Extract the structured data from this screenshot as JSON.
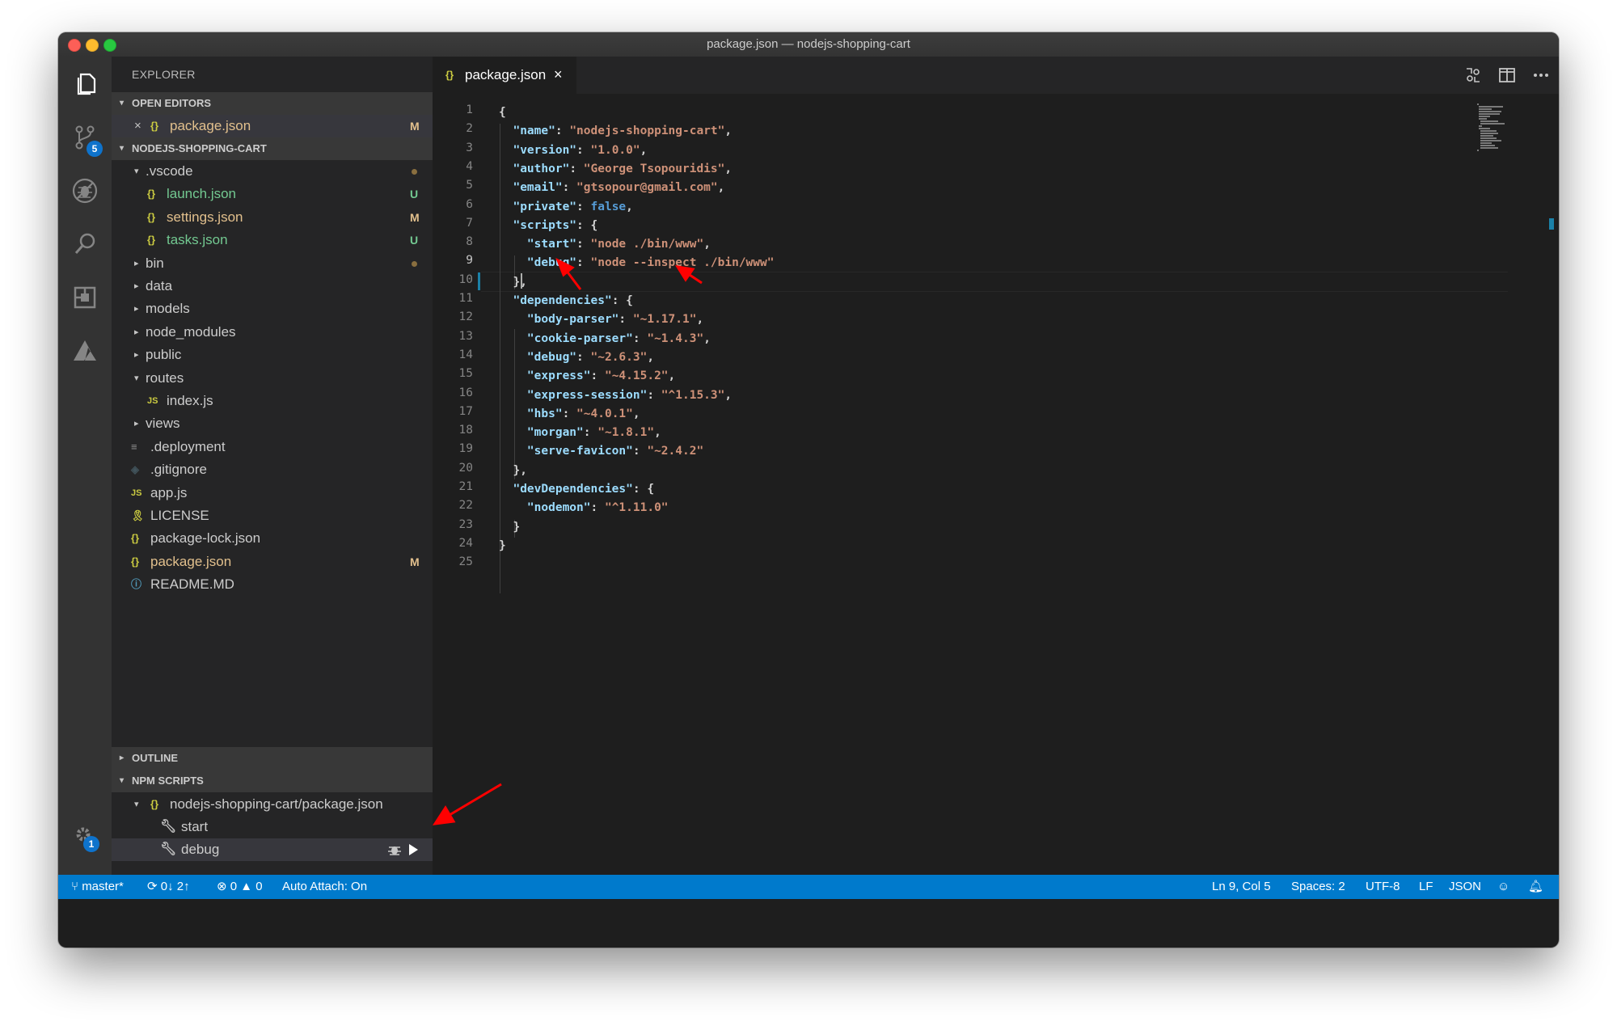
{
  "window": {
    "title": "package.json — nodejs-shopping-cart"
  },
  "activity_bar": {
    "scm_badge": "5",
    "settings_badge": "1"
  },
  "sidebar": {
    "title": "EXPLORER",
    "open_editors": {
      "label": "OPEN EDITORS",
      "items": [
        {
          "icon": "{}",
          "name": "package.json",
          "status": "M"
        }
      ]
    },
    "project": {
      "label": "NODEJS-SHOPPING-CART",
      "items": [
        {
          "name": ".vscode",
          "icon": "",
          "twisty": "▾",
          "status": "",
          "dot": true
        },
        {
          "name": "launch.json",
          "icon": "{}",
          "twisty": "",
          "status": "U"
        },
        {
          "name": "settings.json",
          "icon": "{}",
          "twisty": "",
          "status": "M"
        },
        {
          "name": "tasks.json",
          "icon": "{}",
          "twisty": "",
          "status": "U"
        },
        {
          "name": "bin",
          "icon": "",
          "twisty": "▸",
          "status": "",
          "dot": true
        },
        {
          "name": "data",
          "icon": "",
          "twisty": "▸",
          "status": ""
        },
        {
          "name": "models",
          "icon": "",
          "twisty": "▸",
          "status": ""
        },
        {
          "name": "node_modules",
          "icon": "",
          "twisty": "▸",
          "status": ""
        },
        {
          "name": "public",
          "icon": "",
          "twisty": "▸",
          "status": ""
        },
        {
          "name": "routes",
          "icon": "",
          "twisty": "▾",
          "status": ""
        },
        {
          "name": "index.js",
          "icon": "JS",
          "twisty": "",
          "status": ""
        },
        {
          "name": "views",
          "icon": "",
          "twisty": "▸",
          "status": ""
        },
        {
          "name": ".deployment",
          "icon": "≡",
          "twisty": "",
          "status": ""
        },
        {
          "name": ".gitignore",
          "icon": "◈",
          "twisty": "",
          "status": ""
        },
        {
          "name": "app.js",
          "icon": "JS",
          "twisty": "",
          "status": ""
        },
        {
          "name": "LICENSE",
          "icon": "🎗",
          "twisty": "",
          "status": ""
        },
        {
          "name": "package-lock.json",
          "icon": "{}",
          "twisty": "",
          "status": ""
        },
        {
          "name": "package.json",
          "icon": "{}",
          "twisty": "",
          "status": "M"
        },
        {
          "name": "README.MD",
          "icon": "ⓘ",
          "twisty": "",
          "status": ""
        }
      ]
    },
    "outline": {
      "label": "OUTLINE"
    },
    "npm_scripts": {
      "label": "NPM SCRIPTS",
      "package": "nodejs-shopping-cart/package.json",
      "scripts": [
        {
          "name": "start"
        },
        {
          "name": "debug"
        }
      ]
    }
  },
  "editor": {
    "tab": {
      "icon": "{}",
      "label": "package.json",
      "close": "×"
    },
    "active_line": 9,
    "lines": [
      [
        {
          "t": "{",
          "c": "p"
        }
      ],
      [
        {
          "t": "  "
        },
        {
          "t": "\"name\"",
          "c": "key"
        },
        {
          "t": ": ",
          "c": "p"
        },
        {
          "t": "\"nodejs-shopping-cart\"",
          "c": "str"
        },
        {
          "t": ",",
          "c": "p"
        }
      ],
      [
        {
          "t": "  "
        },
        {
          "t": "\"version\"",
          "c": "key"
        },
        {
          "t": ": ",
          "c": "p"
        },
        {
          "t": "\"1.0.0\"",
          "c": "str"
        },
        {
          "t": ",",
          "c": "p"
        }
      ],
      [
        {
          "t": "  "
        },
        {
          "t": "\"author\"",
          "c": "key"
        },
        {
          "t": ": ",
          "c": "p"
        },
        {
          "t": "\"George Tsopouridis\"",
          "c": "str"
        },
        {
          "t": ",",
          "c": "p"
        }
      ],
      [
        {
          "t": "  "
        },
        {
          "t": "\"email\"",
          "c": "key"
        },
        {
          "t": ": ",
          "c": "p"
        },
        {
          "t": "\"gtsopour@gmail.com\"",
          "c": "str"
        },
        {
          "t": ",",
          "c": "p"
        }
      ],
      [
        {
          "t": "  "
        },
        {
          "t": "\"private\"",
          "c": "key"
        },
        {
          "t": ": ",
          "c": "p"
        },
        {
          "t": "false",
          "c": "kw"
        },
        {
          "t": ",",
          "c": "p"
        }
      ],
      [
        {
          "t": "  "
        },
        {
          "t": "\"scripts\"",
          "c": "key"
        },
        {
          "t": ": {",
          "c": "p"
        }
      ],
      [
        {
          "t": "    "
        },
        {
          "t": "\"start\"",
          "c": "key"
        },
        {
          "t": ": ",
          "c": "p"
        },
        {
          "t": "\"node ./bin/www\"",
          "c": "str"
        },
        {
          "t": ",",
          "c": "p"
        }
      ],
      [
        {
          "t": "    "
        },
        {
          "t": "\"debug\"",
          "c": "key"
        },
        {
          "t": ": ",
          "c": "p"
        },
        {
          "t": "\"node --inspect ./bin/www\"",
          "c": "str"
        }
      ],
      [
        {
          "t": "  "
        },
        {
          "t": "},",
          "c": "p"
        }
      ],
      [
        {
          "t": "  "
        },
        {
          "t": "\"dependencies\"",
          "c": "key"
        },
        {
          "t": ": {",
          "c": "p"
        }
      ],
      [
        {
          "t": "    "
        },
        {
          "t": "\"body-parser\"",
          "c": "key"
        },
        {
          "t": ": ",
          "c": "p"
        },
        {
          "t": "\"~1.17.1\"",
          "c": "str"
        },
        {
          "t": ",",
          "c": "p"
        }
      ],
      [
        {
          "t": "    "
        },
        {
          "t": "\"cookie-parser\"",
          "c": "key"
        },
        {
          "t": ": ",
          "c": "p"
        },
        {
          "t": "\"~1.4.3\"",
          "c": "str"
        },
        {
          "t": ",",
          "c": "p"
        }
      ],
      [
        {
          "t": "    "
        },
        {
          "t": "\"debug\"",
          "c": "key"
        },
        {
          "t": ": ",
          "c": "p"
        },
        {
          "t": "\"~2.6.3\"",
          "c": "str"
        },
        {
          "t": ",",
          "c": "p"
        }
      ],
      [
        {
          "t": "    "
        },
        {
          "t": "\"express\"",
          "c": "key"
        },
        {
          "t": ": ",
          "c": "p"
        },
        {
          "t": "\"~4.15.2\"",
          "c": "str"
        },
        {
          "t": ",",
          "c": "p"
        }
      ],
      [
        {
          "t": "    "
        },
        {
          "t": "\"express-session\"",
          "c": "key"
        },
        {
          "t": ": ",
          "c": "p"
        },
        {
          "t": "\"^1.15.3\"",
          "c": "str"
        },
        {
          "t": ",",
          "c": "p"
        }
      ],
      [
        {
          "t": "    "
        },
        {
          "t": "\"hbs\"",
          "c": "key"
        },
        {
          "t": ": ",
          "c": "p"
        },
        {
          "t": "\"~4.0.1\"",
          "c": "str"
        },
        {
          "t": ",",
          "c": "p"
        }
      ],
      [
        {
          "t": "    "
        },
        {
          "t": "\"morgan\"",
          "c": "key"
        },
        {
          "t": ": ",
          "c": "p"
        },
        {
          "t": "\"~1.8.1\"",
          "c": "str"
        },
        {
          "t": ",",
          "c": "p"
        }
      ],
      [
        {
          "t": "    "
        },
        {
          "t": "\"serve-favicon\"",
          "c": "key"
        },
        {
          "t": ": ",
          "c": "p"
        },
        {
          "t": "\"~2.4.2\"",
          "c": "str"
        }
      ],
      [
        {
          "t": "  "
        },
        {
          "t": "},",
          "c": "p"
        }
      ],
      [
        {
          "t": "  "
        },
        {
          "t": "\"devDependencies\"",
          "c": "key"
        },
        {
          "t": ": {",
          "c": "p"
        }
      ],
      [
        {
          "t": "    "
        },
        {
          "t": "\"nodemon\"",
          "c": "key"
        },
        {
          "t": ": ",
          "c": "p"
        },
        {
          "t": "\"^1.11.0\"",
          "c": "str"
        }
      ],
      [
        {
          "t": "  "
        },
        {
          "t": "}",
          "c": "p"
        }
      ],
      [
        {
          "t": "}",
          "c": "p"
        }
      ],
      []
    ]
  },
  "status_bar": {
    "branch": "master*",
    "sync": "0↓ 2↑",
    "errors": "0",
    "warnings": "0",
    "auto_attach": "Auto Attach: On",
    "position": "Ln 9, Col 5",
    "spaces": "Spaces: 2",
    "encoding": "UTF-8",
    "eol": "LF",
    "language": "JSON"
  },
  "colors": {
    "status_bar": "#007acc",
    "annotation_arrow": "#ff0000",
    "modified": "#e2c08d",
    "untracked": "#73c991"
  }
}
